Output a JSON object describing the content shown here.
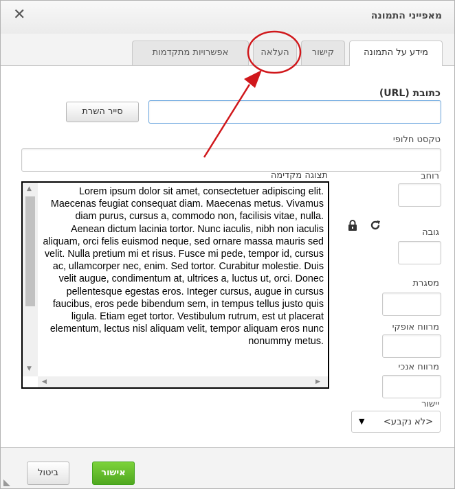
{
  "dialog": {
    "title": "מאפייני התמונה",
    "close_glyph": "✕"
  },
  "tabs": [
    {
      "label": "מידע על התמונה",
      "active": true
    },
    {
      "label": "קישור",
      "active": false
    },
    {
      "label": "העלאה",
      "active": false,
      "highlighted": true
    },
    {
      "label": "אפשרויות מתקדמות",
      "active": false
    }
  ],
  "fields": {
    "url_label": "כתובת (URL)",
    "url_value": "",
    "browse_button": "סייר השרת",
    "alt_label": "טקסט חלופי",
    "alt_value": "",
    "width_label": "רוחב",
    "height_label": "גובה",
    "border_label": "מסגרת",
    "hspace_label": "מרווח אופקי",
    "vspace_label": "מרווח אנכי",
    "align_label": "יישור",
    "align_value": "<לא נקבע>",
    "lock_icon": "lock-icon",
    "reset_icon": "refresh-icon"
  },
  "preview": {
    "label": "תצוגה מקדימה",
    "text": "Lorem ipsum dolor sit amet, consectetuer adipiscing elit. Maecenas feugiat consequat diam. Maecenas metus. Vivamus diam purus, cursus a, commodo non, facilisis vitae, nulla. Aenean dictum lacinia tortor. Nunc iaculis, nibh non iaculis aliquam, orci felis euismod neque, sed ornare massa mauris sed velit. Nulla pretium mi et risus. Fusce mi pede, tempor id, cursus ac, ullamcorper nec, enim. Sed tortor. Curabitur molestie. Duis velit augue, condimentum at, ultrices a, luctus ut, orci. Donec pellentesque egestas eros. Integer cursus, augue in cursus faucibus, eros pede bibendum sem, in tempus tellus justo quis ligula. Etiam eget tortor. Vestibulum rutrum, est ut placerat elementum, lectus nisl aliquam velit, tempor aliquam eros nunc nonummy metus."
  },
  "footer": {
    "ok_label": "אישור",
    "cancel_label": "ביטול"
  },
  "colors": {
    "ok_green": "#50a820",
    "annotation_red": "#d0171b",
    "focus_blue": "#6aa6de"
  }
}
